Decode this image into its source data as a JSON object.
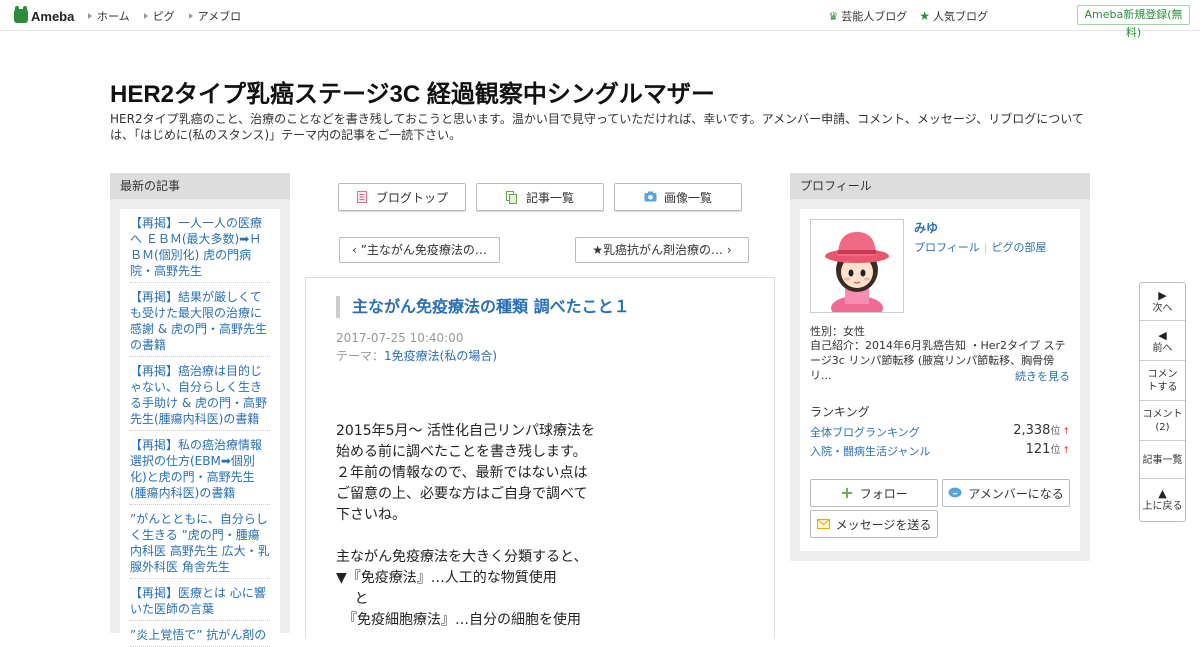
{
  "topbar": {
    "logo": "Ameba",
    "nav": [
      "ホーム",
      "ピグ",
      "アメブロ"
    ],
    "celebrity_blog": "芸能人ブログ",
    "popular_blog": "人気ブログ",
    "signup": "Ameba新規登録(無料)"
  },
  "blog": {
    "title": "HER2タイプ乳癌ステージ3C 経過観察中シングルマザー",
    "description": "HER2タイプ乳癌のこと、治療のことなどを書き残しておこうと思います。温かい目で見守っていただければ、幸いです。アメンバー申請、コメント、メッセージ、リブログについては、「はじめに(私のスタンス)」テーマ内の記事をご一読下さい。"
  },
  "sidebar_left": {
    "heading": "最新の記事",
    "items": [
      "【再掲】一人一人の医療へ ＥＢＭ(最大多数)➡ＨＢＭ(個別化) 虎の門病院・高野先生",
      "【再掲】結果が厳しくても受けた最大限の治療に感謝 & 虎の門・高野先生の書籍",
      "【再掲】癌治療は目的じゃない、自分らしく生きる手助け & 虎の門・高野先生(腫瘍内科医)の書籍",
      "【再掲】私の癌治療情報選択の仕方(EBM➡個別化)と虎の門・高野先生(腫瘍内科医)の書籍",
      "”がんとともに、自分らしく生きる ”虎の門・腫瘍内科医 高野先生 広大・乳腺外科医 角舎先生",
      "【再掲】医療とは 心に響いた医師の言葉",
      "”炎上覚悟で” 抗がん剤の"
    ]
  },
  "center": {
    "buttons": {
      "blog_top": "ブログトップ",
      "article_list": "記事一覧",
      "image_list": "画像一覧"
    },
    "prev_article": "”主ながん免疫療法の…",
    "next_article": "★乳癌抗がん剤治療の…",
    "article": {
      "title": "主ながん免疫療法の種類 調べたこと１",
      "date": "2017-07-25 10:40:00",
      "theme_label": "テーマ：",
      "theme": "1免疫療法(私の場合)",
      "body": "2015年5月～ 活性化自己リンパ球療法を\n始める前に調べたことを書き残します。\n２年前の情報なので、最新ではない点は\nご留意の上、必要な方はご自身で調べて\n下さいね。\n\n主ながん免疫療法を大きく分類すると、\n▼『免疫療法』…人工的な物質使用\n　 と\n　『免疫細胞療法』…自分の細胞を使用"
    }
  },
  "profile": {
    "heading": "プロフィール",
    "name": "みゆ",
    "link_profile": "プロフィール",
    "link_pig": "ピグの部屋",
    "gender": "性別：女性",
    "intro": "自己紹介：2014年6月乳癌告知 ・Her2タイプ ステージ3c リンパ節転移 (腋窩リンパ節転移、胸骨傍リ...",
    "more": "続きを見る",
    "ranking_heading": "ランキング",
    "rankings": [
      {
        "category": "全体ブログランキング",
        "value": "2,338",
        "unit": "位"
      },
      {
        "category": "入院・闘病生活ジャンル",
        "value": "121",
        "unit": "位"
      }
    ],
    "follow": "フォロー",
    "amember": "アメンバーになる",
    "message": "メッセージを送る"
  },
  "floatnav": {
    "next": "次へ",
    "prev": "前へ",
    "comment_do": "コメントする",
    "comment_count": "コメント(2)",
    "article_list": "記事一覧",
    "top": "上に戻る"
  },
  "colors": {
    "brand_green": "#2d8c3c",
    "link_blue": "#2a6fb5"
  }
}
